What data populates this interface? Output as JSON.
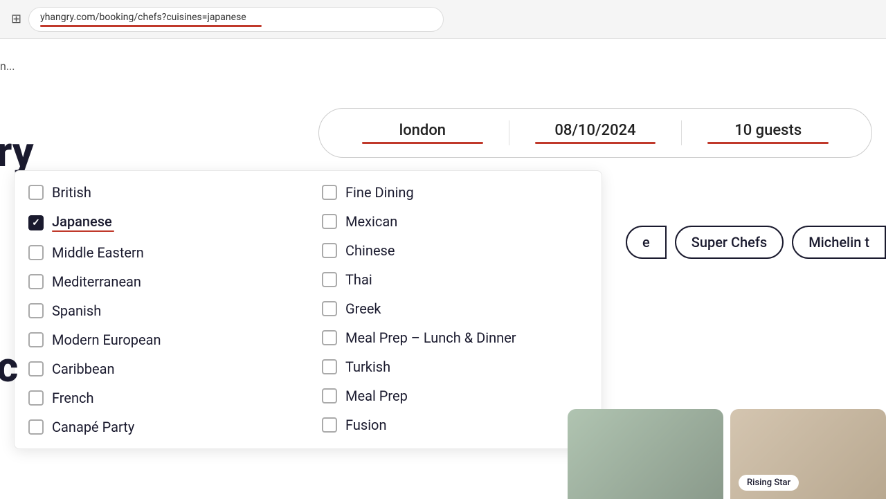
{
  "browser": {
    "url": "yhangry.com/booking/chefs?cuisines=japanese",
    "icon": "⊞"
  },
  "top_left_partial": "n...",
  "search_bar": {
    "location_label": "london",
    "date_label": "08/10/2024",
    "guests_label": "10 guests"
  },
  "left_partial_top": "ry",
  "left_partial_bottom": "c",
  "left_column_cuisines": [
    {
      "id": "british",
      "label": "British",
      "checked": false
    },
    {
      "id": "japanese",
      "label": "Japanese",
      "checked": true
    },
    {
      "id": "middle-eastern",
      "label": "Middle Eastern",
      "checked": false
    },
    {
      "id": "mediterranean",
      "label": "Mediterranean",
      "checked": false
    },
    {
      "id": "spanish",
      "label": "Spanish",
      "checked": false
    },
    {
      "id": "modern-european",
      "label": "Modern European",
      "checked": false
    },
    {
      "id": "caribbean",
      "label": "Caribbean",
      "checked": false
    },
    {
      "id": "french",
      "label": "French",
      "checked": false
    },
    {
      "id": "canape-party",
      "label": "Canapé Party",
      "checked": false
    }
  ],
  "right_column_cuisines": [
    {
      "id": "fine-dining",
      "label": "Fine Dining",
      "checked": false
    },
    {
      "id": "mexican",
      "label": "Mexican",
      "checked": false
    },
    {
      "id": "chinese",
      "label": "Chinese",
      "checked": false
    },
    {
      "id": "thai",
      "label": "Thai",
      "checked": false
    },
    {
      "id": "greek",
      "label": "Greek",
      "checked": false
    },
    {
      "id": "meal-prep-lunch-dinner",
      "label": "Meal Prep – Lunch & Dinner",
      "checked": false
    },
    {
      "id": "turkish",
      "label": "Turkish",
      "checked": false
    },
    {
      "id": "meal-prep",
      "label": "Meal Prep",
      "checked": false
    },
    {
      "id": "fusion",
      "label": "Fusion",
      "checked": false
    }
  ],
  "filter_chips": [
    {
      "id": "chip-partial-left",
      "label": "e",
      "partial": true
    },
    {
      "id": "chip-super-chefs",
      "label": "Super Chefs",
      "partial": false
    },
    {
      "id": "chip-michelin",
      "label": "Michelin t",
      "partial": true
    }
  ],
  "chef_cards": [
    {
      "id": "card-1",
      "badge": ""
    },
    {
      "id": "card-2",
      "badge": "Rising Star"
    }
  ]
}
